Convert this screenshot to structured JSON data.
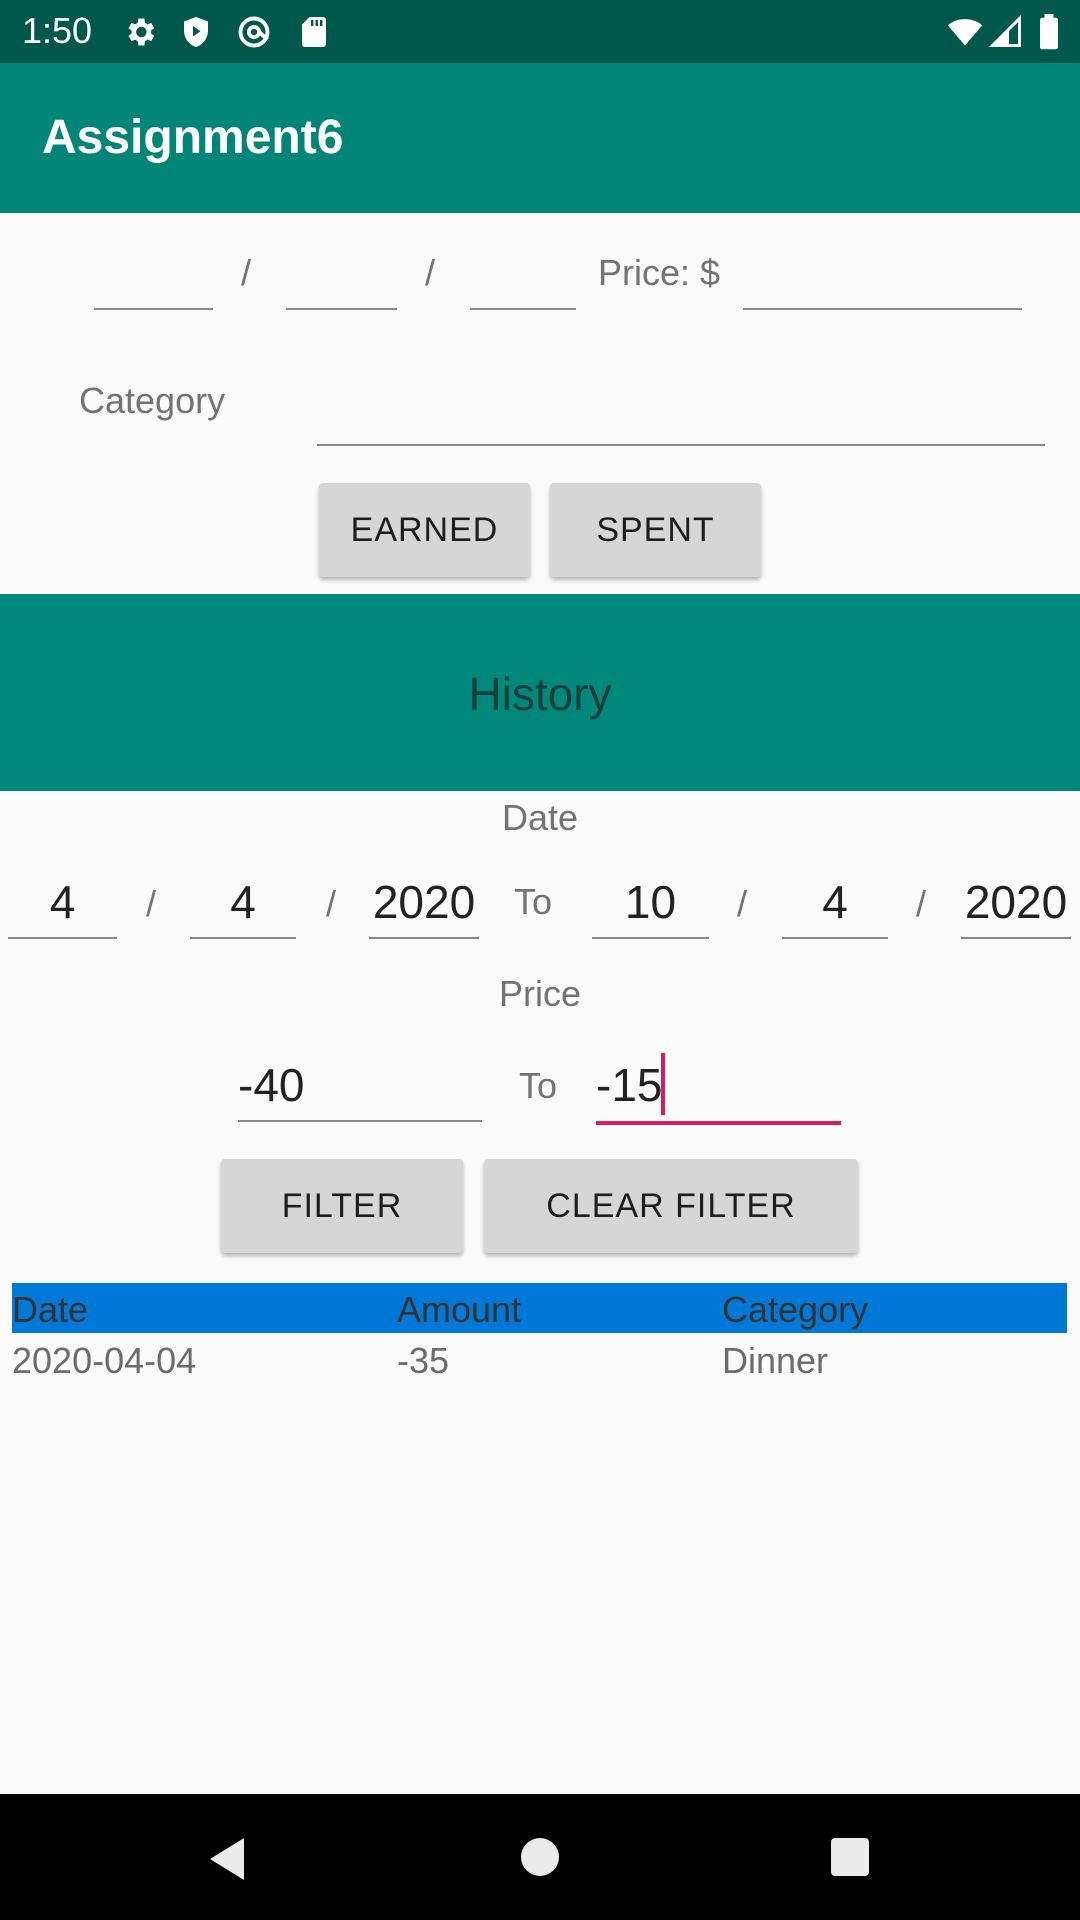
{
  "status_bar": {
    "time": "1:50",
    "icons_left": [
      "gear-icon",
      "shield-play-icon",
      "at-icon",
      "sd-card-icon"
    ],
    "icons_right": [
      "wifi-icon",
      "signal-icon",
      "battery-icon"
    ]
  },
  "app_bar": {
    "title": "Assignment6"
  },
  "entry_form": {
    "date_separator": "/",
    "price_label": "Price: $",
    "category_label": "Category",
    "earned_label": "EARNED",
    "spent_label": "SPENT"
  },
  "history": {
    "title": "History",
    "date_label": "Date",
    "from_date": {
      "month": "4",
      "day": "4",
      "year": "2020"
    },
    "to_label": "To",
    "to_date": {
      "month": "10",
      "day": "4",
      "year": "2020"
    },
    "price_label": "Price",
    "price_from": "-40",
    "price_to": "-15",
    "filter_label": "FILTER",
    "clear_filter_label": "CLEAR FILTER"
  },
  "table": {
    "headers": [
      "Date",
      "Amount",
      "Category"
    ],
    "rows": [
      [
        "2020-04-04",
        "-35",
        "Dinner"
      ]
    ]
  },
  "colors": {
    "status_bar": "#00574b",
    "app_bar": "#008577",
    "history_banner": "#00897b",
    "table_header": "#0078d7",
    "accent_caret": "#d81b60"
  },
  "nav_bar": {
    "icons": [
      "back-icon",
      "home-icon",
      "recents-icon"
    ]
  }
}
